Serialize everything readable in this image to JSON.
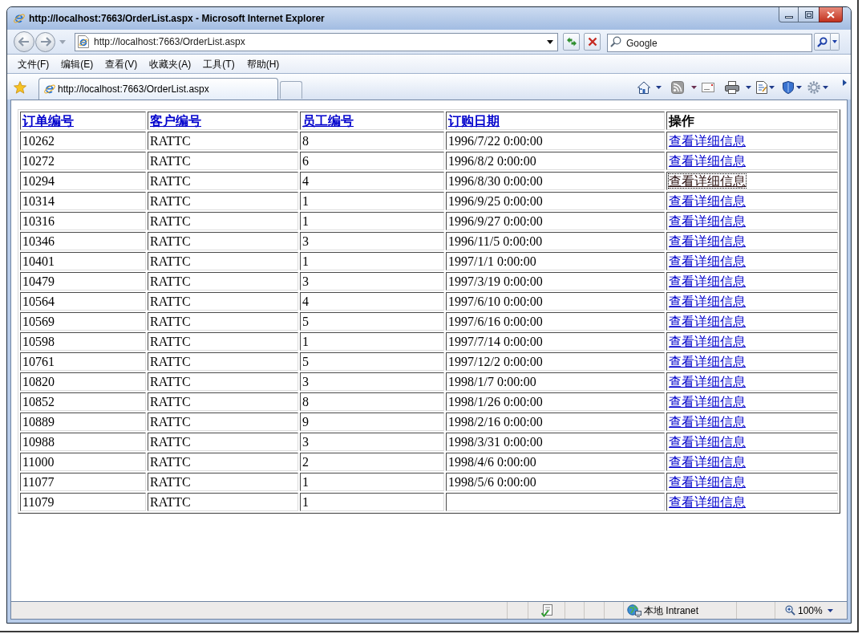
{
  "window": {
    "title": "http://localhost:7663/OrderList.aspx - Microsoft Internet Explorer"
  },
  "address_bar": {
    "url": "http://localhost:7663/OrderList.aspx"
  },
  "search": {
    "placeholder": "Google"
  },
  "menu": [
    "文件(F)",
    "编辑(E)",
    "查看(V)",
    "收藏夹(A)",
    "工具(T)",
    "帮助(H)"
  ],
  "tabs": [
    {
      "label": "http://localhost:7663/OrderList.aspx",
      "selected": true
    }
  ],
  "table": {
    "columns": [
      {
        "label": "订单编号",
        "kind": "link"
      },
      {
        "label": "客户编号",
        "kind": "link"
      },
      {
        "label": "员工编号",
        "kind": "link"
      },
      {
        "label": "订购日期",
        "kind": "link"
      },
      {
        "label": "操作",
        "kind": "text"
      }
    ],
    "rows": [
      {
        "cells": [
          "10262",
          "RATTC",
          "8",
          "1996/7/22 0:00:00"
        ],
        "action": "查看详细信息",
        "focused": false
      },
      {
        "cells": [
          "10272",
          "RATTC",
          "6",
          "1996/8/2 0:00:00"
        ],
        "action": "查看详细信息",
        "focused": false
      },
      {
        "cells": [
          "10294",
          "RATTC",
          "4",
          "1996/8/30 0:00:00"
        ],
        "action": "查看详细信息",
        "focused": true
      },
      {
        "cells": [
          "10314",
          "RATTC",
          "1",
          "1996/9/25 0:00:00"
        ],
        "action": "查看详细信息",
        "focused": false
      },
      {
        "cells": [
          "10316",
          "RATTC",
          "1",
          "1996/9/27 0:00:00"
        ],
        "action": "查看详细信息",
        "focused": false
      },
      {
        "cells": [
          "10346",
          "RATTC",
          "3",
          "1996/11/5 0:00:00"
        ],
        "action": "查看详细信息",
        "focused": false
      },
      {
        "cells": [
          "10401",
          "RATTC",
          "1",
          "1997/1/1 0:00:00"
        ],
        "action": "查看详细信息",
        "focused": false
      },
      {
        "cells": [
          "10479",
          "RATTC",
          "3",
          "1997/3/19 0:00:00"
        ],
        "action": "查看详细信息",
        "focused": false
      },
      {
        "cells": [
          "10564",
          "RATTC",
          "4",
          "1997/6/10 0:00:00"
        ],
        "action": "查看详细信息",
        "focused": false
      },
      {
        "cells": [
          "10569",
          "RATTC",
          "5",
          "1997/6/16 0:00:00"
        ],
        "action": "查看详细信息",
        "focused": false
      },
      {
        "cells": [
          "10598",
          "RATTC",
          "1",
          "1997/7/14 0:00:00"
        ],
        "action": "查看详细信息",
        "focused": false
      },
      {
        "cells": [
          "10761",
          "RATTC",
          "5",
          "1997/12/2 0:00:00"
        ],
        "action": "查看详细信息",
        "focused": false
      },
      {
        "cells": [
          "10820",
          "RATTC",
          "3",
          "1998/1/7 0:00:00"
        ],
        "action": "查看详细信息",
        "focused": false
      },
      {
        "cells": [
          "10852",
          "RATTC",
          "8",
          "1998/1/26 0:00:00"
        ],
        "action": "查看详细信息",
        "focused": false
      },
      {
        "cells": [
          "10889",
          "RATTC",
          "9",
          "1998/2/16 0:00:00"
        ],
        "action": "查看详细信息",
        "focused": false
      },
      {
        "cells": [
          "10988",
          "RATTC",
          "3",
          "1998/3/31 0:00:00"
        ],
        "action": "查看详细信息",
        "focused": false
      },
      {
        "cells": [
          "11000",
          "RATTC",
          "2",
          "1998/4/6 0:00:00"
        ],
        "action": "查看详细信息",
        "focused": false
      },
      {
        "cells": [
          "11077",
          "RATTC",
          "1",
          "1998/5/6 0:00:00"
        ],
        "action": "查看详细信息",
        "focused": false
      },
      {
        "cells": [
          "11079",
          "RATTC",
          "1"
        ],
        "action": "查看详细信息",
        "focused": false
      }
    ]
  },
  "status_bar": {
    "zone": "本地 Intranet",
    "zoom": "100%"
  }
}
